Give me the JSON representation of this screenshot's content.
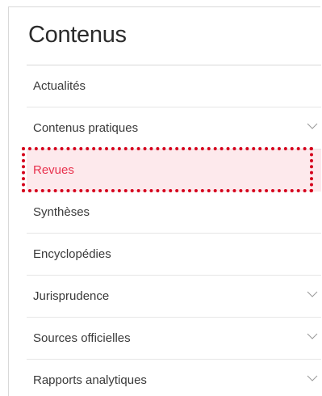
{
  "panel": {
    "title": "Contenus"
  },
  "menu": {
    "items": [
      {
        "label": "Actualités",
        "expandable": false
      },
      {
        "label": "Contenus pratiques",
        "expandable": true
      },
      {
        "label": "Revues",
        "expandable": false,
        "active": true
      },
      {
        "label": "Synthèses",
        "expandable": false
      },
      {
        "label": "Encyclopédies",
        "expandable": false
      },
      {
        "label": "Jurisprudence",
        "expandable": true
      },
      {
        "label": "Sources officielles",
        "expandable": true
      },
      {
        "label": "Rapports analytiques",
        "expandable": true
      }
    ]
  },
  "colors": {
    "active_text": "#e8314d",
    "active_background": "#fde9ec",
    "highlight_border": "#d5001c",
    "chevron": "#9a9a9a"
  },
  "icons": {
    "chevron": "chevron-down-icon"
  }
}
